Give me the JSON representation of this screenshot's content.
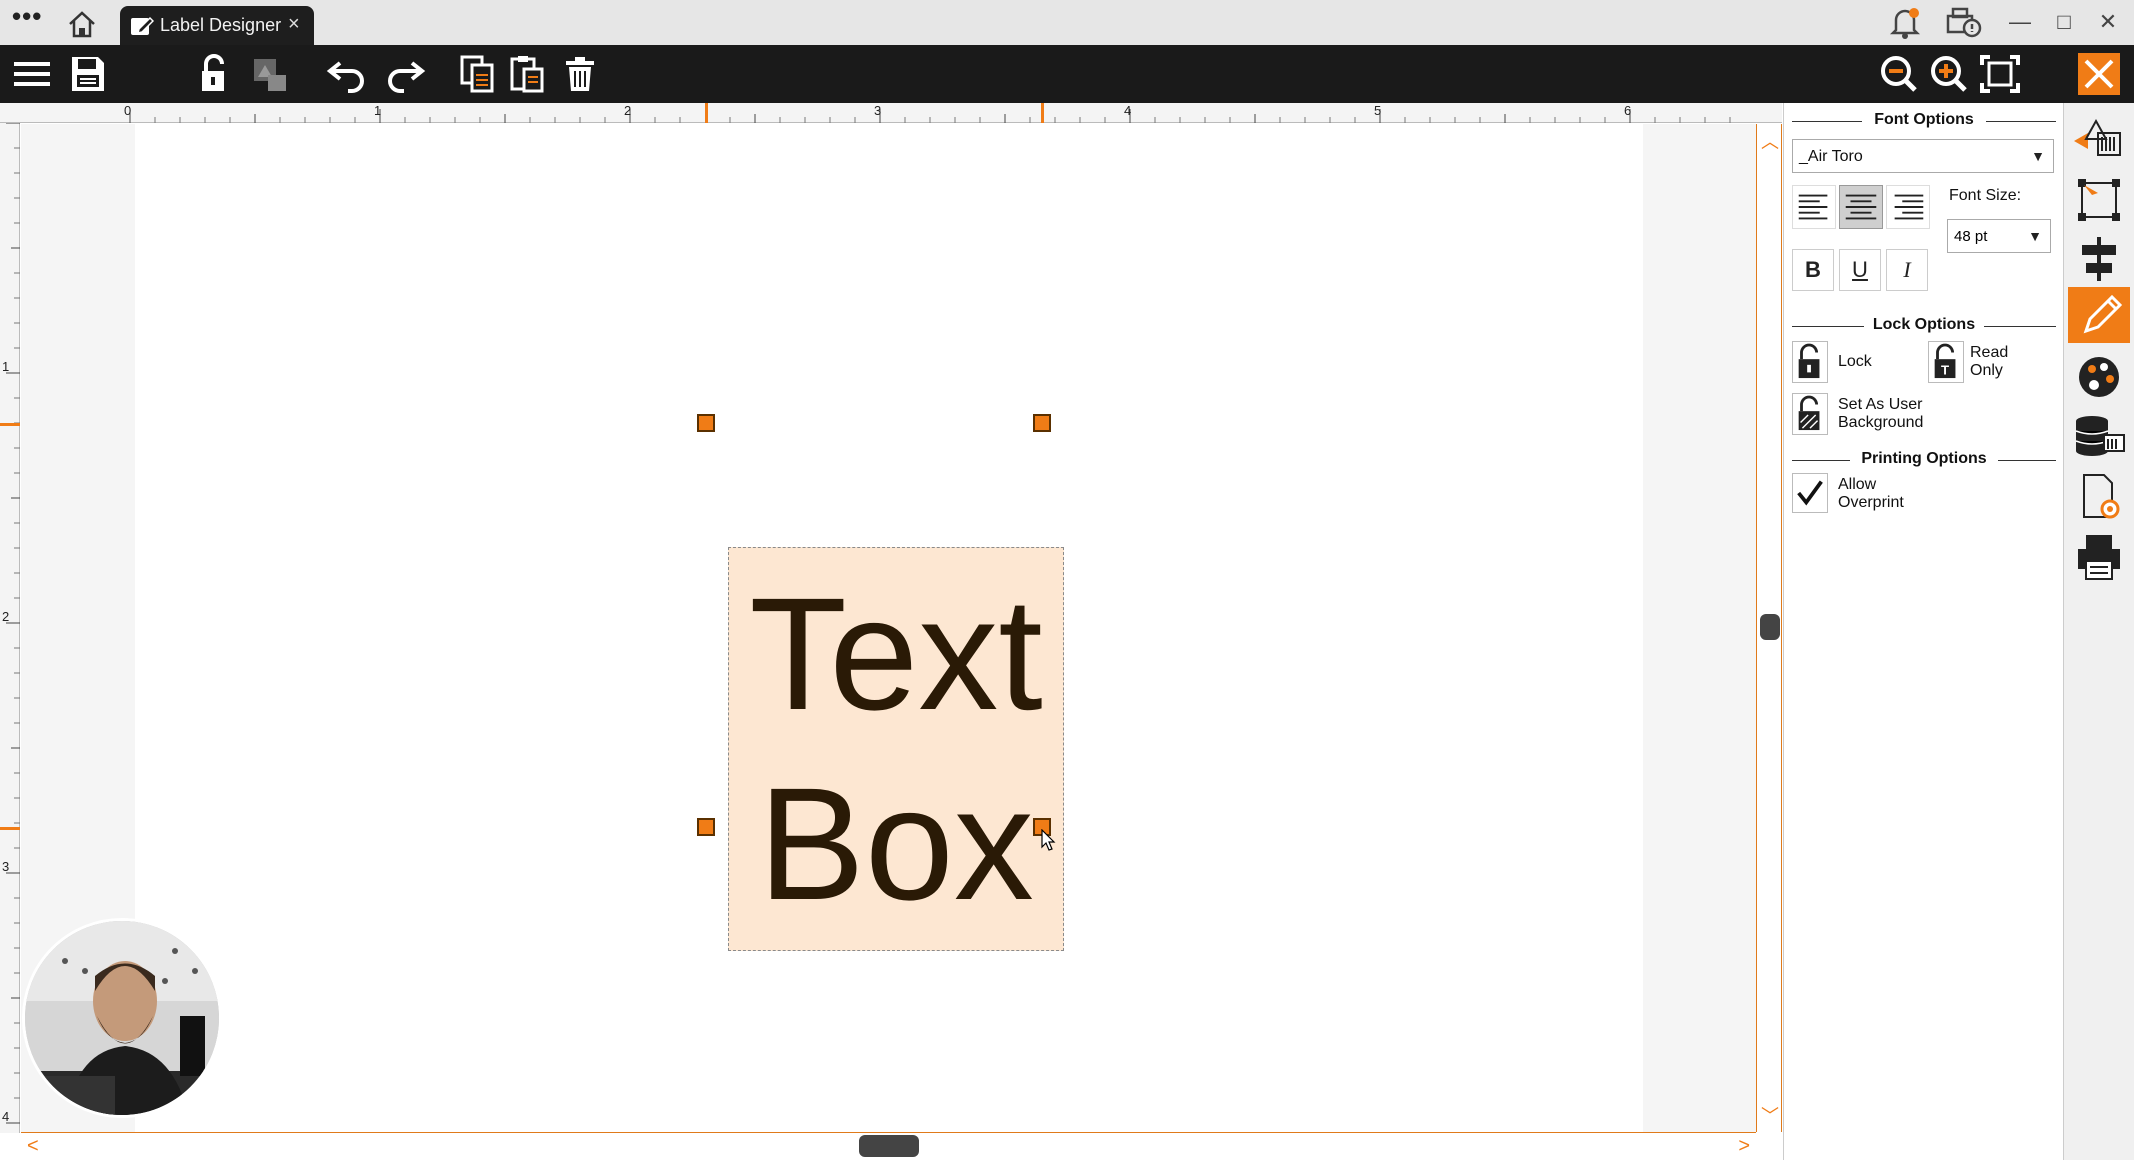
{
  "titlebar": {
    "menu_dots": "•••",
    "tab_label": "Label Designer",
    "tab_close": "×",
    "minimize": "—",
    "maximize": "□",
    "close": "✕"
  },
  "ruler": {
    "top_numbers": [
      "0",
      "1",
      "2",
      "3",
      "4",
      "5",
      "6"
    ],
    "left_numbers": [
      "1",
      "2",
      "3",
      "4"
    ]
  },
  "canvas": {
    "text_box_content": "Text Box"
  },
  "panel": {
    "font_options_title": "Font Options",
    "font_name": "_Air Toro",
    "font_size_label": "Font Size:",
    "font_size_value": "48 pt",
    "bold": "B",
    "underline": "U",
    "italic": "I",
    "lock_options_title": "Lock Options",
    "lock_label": "Lock",
    "read_only_label": "Read Only",
    "set_background_label": "Set As User Background",
    "printing_options_title": "Printing Options",
    "allow_overprint_label": "Allow Overprint",
    "allow_overprint_checked": true
  },
  "colors": {
    "accent": "#f07c16",
    "toolbar": "#1a1a1a",
    "text_box_fill": "#fde7d2"
  }
}
